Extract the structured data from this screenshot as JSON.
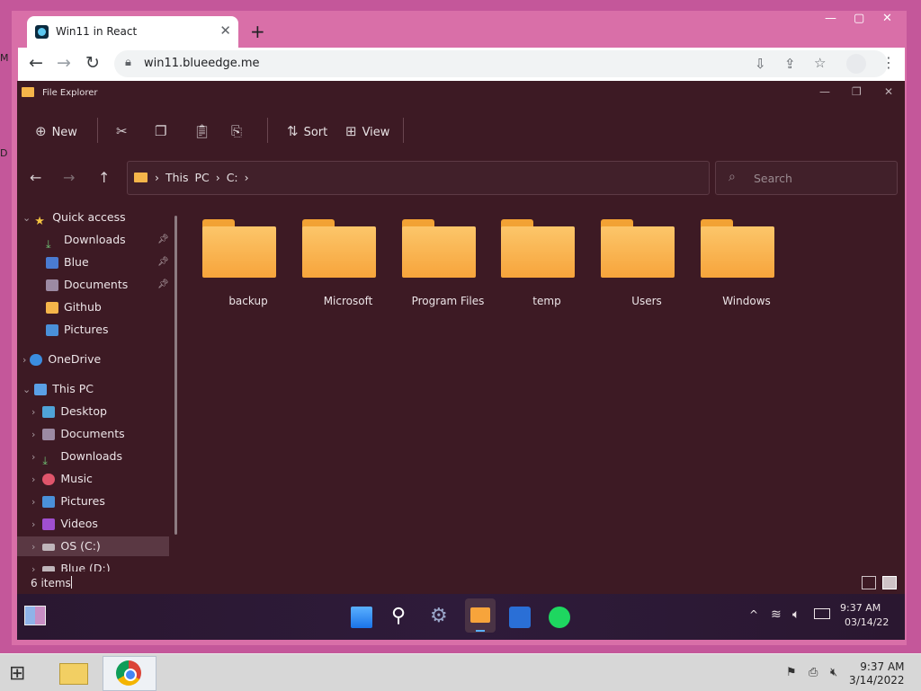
{
  "browser": {
    "tab_title": "Win11 in React",
    "tab_close": "✕",
    "new_tab": "+",
    "url": "win11.blueedge.me",
    "window_controls": {
      "minimize": "—",
      "maximize": "▢",
      "close": "✕"
    }
  },
  "explorer": {
    "title": "File Explorer",
    "commands": {
      "new": "New",
      "sort": "Sort",
      "view": "View"
    },
    "breadcrumb": "› This PC › C: ›",
    "search_placeholder": "Search",
    "sidebar": {
      "quick_access": {
        "label": "Quick access",
        "items": [
          {
            "label": "Downloads",
            "pinned": true
          },
          {
            "label": "Blue",
            "pinned": true
          },
          {
            "label": "Documents",
            "pinned": true
          },
          {
            "label": "Github",
            "pinned": false
          },
          {
            "label": "Pictures",
            "pinned": false
          }
        ]
      },
      "onedrive": "OneDrive",
      "this_pc": {
        "label": "This PC",
        "items": [
          {
            "label": "Desktop"
          },
          {
            "label": "Documents"
          },
          {
            "label": "Downloads"
          },
          {
            "label": "Music"
          },
          {
            "label": "Pictures"
          },
          {
            "label": "Videos"
          },
          {
            "label": "OS (C:)"
          },
          {
            "label": "Blue (D:)"
          }
        ]
      }
    },
    "folders": [
      "backup",
      "Microsoft",
      "Program Files",
      "temp",
      "Users",
      "Windows"
    ],
    "status": "6 items"
  },
  "win11_taskbar": {
    "time": "9:37 AM",
    "date": "03/14/22"
  },
  "host_taskbar": {
    "time": "9:37 AM",
    "date": "3/14/2022"
  },
  "colors": {
    "folder": "#f7a43b",
    "explorer_bg": "#3d1a24",
    "chrome_frame": "#d96fa8"
  }
}
